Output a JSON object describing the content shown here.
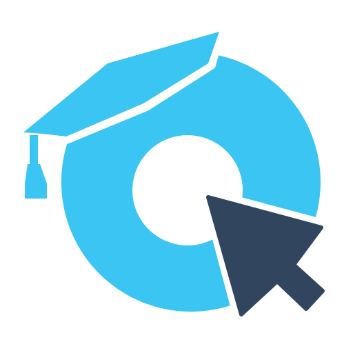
{
  "logo": {
    "icon_name": "graduation-cap-ring-cursor-icon",
    "colors": {
      "ring": "#3BC5F3",
      "cap": "#3BC5F3",
      "cursor": "#32455F",
      "background": "#FFFFFF",
      "outline": "#FFFFFF"
    }
  }
}
